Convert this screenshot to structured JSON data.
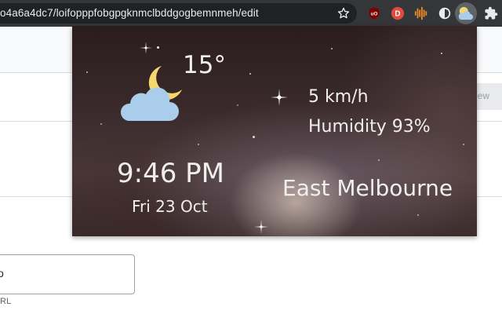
{
  "browser": {
    "url": "o4a6a4dc7/loifopppfobgpgknmclbddgogbemnmeh/edit",
    "extension_icons": [
      "star-icon",
      "ublock-icon",
      "d-extension-icon",
      "audio-wave-icon",
      "contrast-icon",
      "weather-extension-icon",
      "puzzle-icon"
    ],
    "d_extension_letter": "D"
  },
  "page": {
    "preview_label": "iew",
    "url_input_value": "o",
    "url_hint": "RL"
  },
  "weather": {
    "temperature": "15°",
    "wind": "5 km/h",
    "humidity": "Humidity 93%",
    "time": "9:46 PM",
    "date": "Fri 23 Oct",
    "location": "East Melbourne",
    "condition_icon": "night-cloudy-icon"
  },
  "colors": {
    "toolbar": "#35363a",
    "omnibox": "#202124",
    "moon": "#f5d76e",
    "cloud": "#a9cdea",
    "popup_text": "#f1eeee"
  }
}
